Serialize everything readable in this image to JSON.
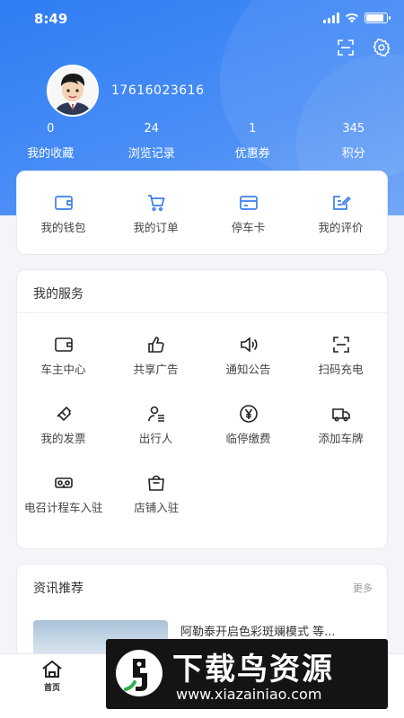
{
  "status_bar": {
    "time": "8:49"
  },
  "colors": {
    "primary": "#2f7df4",
    "icon": "#3a7ff0",
    "background": "#f3f5f8"
  },
  "header": {
    "phone": "17616023616",
    "actions": [
      {
        "icon": "scan-icon"
      },
      {
        "icon": "gear-icon"
      }
    ],
    "stats": [
      {
        "value": "0",
        "label": "我的收藏"
      },
      {
        "value": "24",
        "label": "浏览记录"
      },
      {
        "value": "1",
        "label": "优惠券"
      },
      {
        "value": "345",
        "label": "积分"
      }
    ]
  },
  "quick": [
    {
      "label": "我的钱包",
      "icon": "wallet-icon"
    },
    {
      "label": "我的订单",
      "icon": "cart-icon"
    },
    {
      "label": "停车卡",
      "icon": "card-icon"
    },
    {
      "label": "我的评价",
      "icon": "edit-icon"
    }
  ],
  "services": {
    "title": "我的服务",
    "items": [
      {
        "label": "车主中心",
        "icon": "wallet-icon"
      },
      {
        "label": "共享广告",
        "icon": "thumbs-up-icon"
      },
      {
        "label": "通知公告",
        "icon": "speaker-icon"
      },
      {
        "label": "扫码充电",
        "icon": "scan-icon"
      },
      {
        "label": "我的发票",
        "icon": "ticket-icon"
      },
      {
        "label": "出行人",
        "icon": "person-list-icon"
      },
      {
        "label": "临停缴费",
        "icon": "yen-icon"
      },
      {
        "label": "添加车牌",
        "icon": "truck-icon"
      },
      {
        "label": "电召计程车入驻",
        "icon": "vr-glasses-icon"
      },
      {
        "label": "店铺入驻",
        "icon": "shopping-bag-icon"
      }
    ]
  },
  "news": {
    "title": "资讯推荐",
    "more": "更多",
    "items": [
      {
        "title": "阿勒泰开启色彩斑斓模式 等..."
      }
    ]
  },
  "tabbar": {
    "home": "首页"
  },
  "watermark": {
    "title": "下载鸟资源",
    "url": "www.xiazainiao.com"
  }
}
